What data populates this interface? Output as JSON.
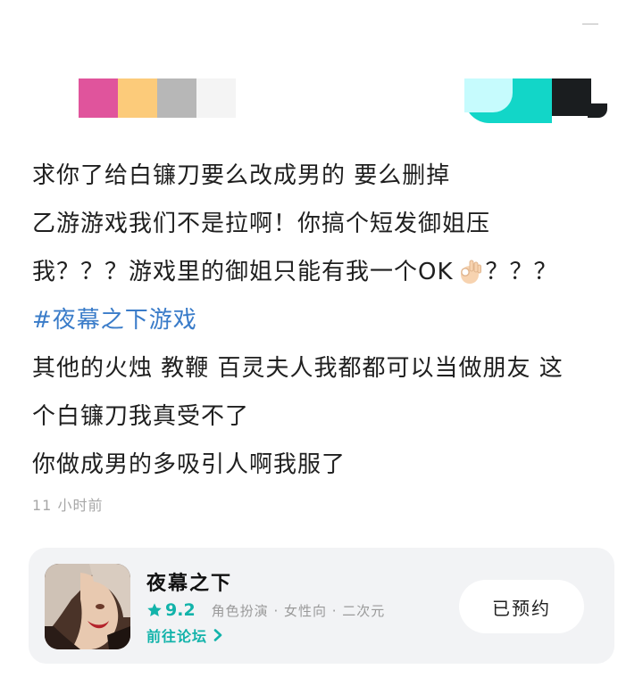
{
  "post": {
    "line1": "求你了给白镰刀要么改成男的 要么删掉",
    "line2": "乙游游戏我们不是拉啊！你搞个短发御姐压",
    "line3_a": "我？？？游戏里的御姐只能有我一个OK",
    "line3_b": "？？？",
    "hashtag": "#夜幕之下游戏",
    "line4": "其他的火烛 教鞭 百灵夫人我都都可以当做朋友 这",
    "line5": "个白镰刀我真受不了",
    "line6": "你做成男的多吸引人啊我服了"
  },
  "meta": {
    "time_ago": "11 小时前"
  },
  "game_card": {
    "name": "夜幕之下",
    "rating": "9.2",
    "genres": "角色扮演 · 女性向 · 二次元",
    "forum_link": "前往论坛",
    "reserve_button": "已预约"
  },
  "colors": {
    "accent": "#12b3aa",
    "hashtag": "#3a7cc9",
    "strip": [
      "#e0549c",
      "#fccb7a",
      "#b7b7b7",
      "#f4f4f4"
    ]
  },
  "icons": {
    "rating": "star-icon",
    "forum": "chevron-right-icon",
    "emoji": "ok-hand-icon"
  }
}
